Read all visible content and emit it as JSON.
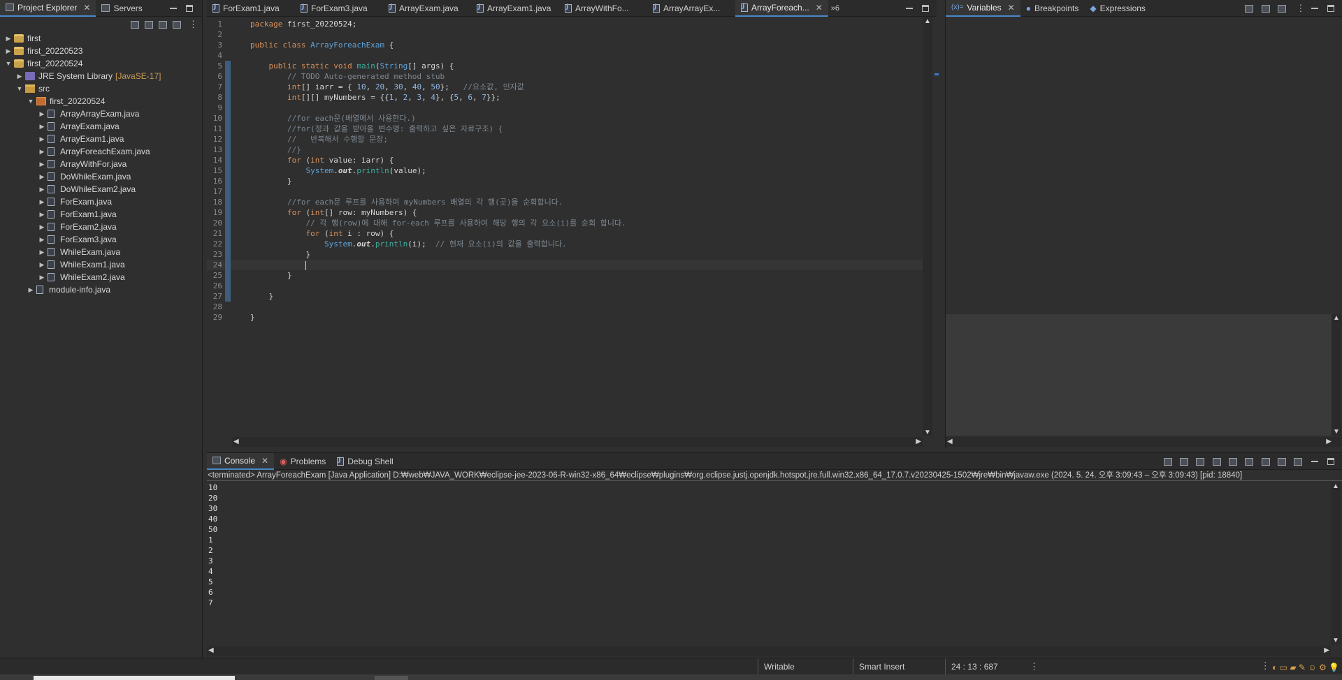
{
  "explorer": {
    "tabs": [
      {
        "label": "Project Explorer",
        "active": true
      },
      {
        "label": "Servers",
        "active": false
      }
    ],
    "tree": [
      {
        "label": "first",
        "kind": "project",
        "expanded": false,
        "depth": 0
      },
      {
        "label": "first_20220523",
        "kind": "project",
        "expanded": false,
        "depth": 0
      },
      {
        "label": "first_20220524",
        "kind": "project",
        "expanded": true,
        "depth": 0
      },
      {
        "label": "JRE System Library",
        "decor": "[JavaSE-17]",
        "kind": "library",
        "expanded": false,
        "depth": 1
      },
      {
        "label": "src",
        "kind": "source",
        "expanded": true,
        "depth": 1
      },
      {
        "label": "first_20220524",
        "kind": "package",
        "expanded": true,
        "depth": 2
      },
      {
        "label": "ArrayArrayExam.java",
        "kind": "java",
        "expanded": false,
        "depth": 3
      },
      {
        "label": "ArrayExam.java",
        "kind": "java",
        "expanded": false,
        "depth": 3
      },
      {
        "label": "ArrayExam1.java",
        "kind": "java",
        "expanded": false,
        "depth": 3
      },
      {
        "label": "ArrayForeachExam.java",
        "kind": "java",
        "expanded": false,
        "depth": 3
      },
      {
        "label": "ArrayWithFor.java",
        "kind": "java",
        "expanded": false,
        "depth": 3
      },
      {
        "label": "DoWhileExam.java",
        "kind": "java",
        "expanded": false,
        "depth": 3
      },
      {
        "label": "DoWhileExam2.java",
        "kind": "java",
        "expanded": false,
        "depth": 3
      },
      {
        "label": "ForExam.java",
        "kind": "java",
        "expanded": false,
        "depth": 3
      },
      {
        "label": "ForExam1.java",
        "kind": "java",
        "expanded": false,
        "depth": 3
      },
      {
        "label": "ForExam2.java",
        "kind": "java",
        "expanded": false,
        "depth": 3
      },
      {
        "label": "ForExam3.java",
        "kind": "java",
        "expanded": false,
        "depth": 3
      },
      {
        "label": "WhileExam.java",
        "kind": "java",
        "expanded": false,
        "depth": 3
      },
      {
        "label": "WhileExam1.java",
        "kind": "java",
        "expanded": false,
        "depth": 3
      },
      {
        "label": "WhileExam2.java",
        "kind": "java",
        "expanded": false,
        "depth": 3
      },
      {
        "label": "module-info.java",
        "kind": "java",
        "expanded": false,
        "depth": 2
      }
    ]
  },
  "editor": {
    "tabs": [
      {
        "label": "ForExam1.java",
        "active": false
      },
      {
        "label": "ForExam3.java",
        "active": false
      },
      {
        "label": "ArrayExam.java",
        "active": false
      },
      {
        "label": "ArrayExam1.java",
        "active": false
      },
      {
        "label": "ArrayWithFo...",
        "active": false
      },
      {
        "label": "ArrayArrayEx...",
        "active": false
      },
      {
        "label": "ArrayForeach...",
        "active": true
      }
    ],
    "overflow": "»6",
    "cursor_line": 24,
    "lines": [
      [
        {
          "t": "package",
          "c": "kw"
        },
        {
          "t": " first_20220524;"
        }
      ],
      [],
      [
        {
          "t": "public class ",
          "c": "kw"
        },
        {
          "t": "ArrayForeachExam",
          "c": "ty"
        },
        {
          "t": " {"
        }
      ],
      [],
      [
        {
          "t": "    public static void ",
          "c": "kw"
        },
        {
          "t": "main",
          "c": "fn"
        },
        {
          "t": "("
        },
        {
          "t": "String",
          "c": "ty"
        },
        {
          "t": "[] args) {"
        }
      ],
      [
        {
          "t": "        // TODO Auto-generated method stub",
          "c": "cm"
        }
      ],
      [
        {
          "t": "        "
        },
        {
          "t": "int",
          "c": "kw"
        },
        {
          "t": "[] iarr = { "
        },
        {
          "t": "10",
          "c": "num"
        },
        {
          "t": ", "
        },
        {
          "t": "20",
          "c": "num"
        },
        {
          "t": ", "
        },
        {
          "t": "30",
          "c": "num"
        },
        {
          "t": ", "
        },
        {
          "t": "40",
          "c": "num"
        },
        {
          "t": ", "
        },
        {
          "t": "50",
          "c": "num"
        },
        {
          "t": "};   "
        },
        {
          "t": "//요소값, 인자값",
          "c": "cm"
        }
      ],
      [
        {
          "t": "        "
        },
        {
          "t": "int",
          "c": "kw"
        },
        {
          "t": "[][] myNumbers = {{"
        },
        {
          "t": "1",
          "c": "num"
        },
        {
          "t": ", "
        },
        {
          "t": "2",
          "c": "num"
        },
        {
          "t": ", "
        },
        {
          "t": "3",
          "c": "num"
        },
        {
          "t": ", "
        },
        {
          "t": "4",
          "c": "num"
        },
        {
          "t": "}, {"
        },
        {
          "t": "5",
          "c": "num"
        },
        {
          "t": ", "
        },
        {
          "t": "6",
          "c": "num"
        },
        {
          "t": ", "
        },
        {
          "t": "7",
          "c": "num"
        },
        {
          "t": "}};"
        }
      ],
      [],
      [
        {
          "t": "        //for each문(배열에서 사용한다.)",
          "c": "cm"
        }
      ],
      [
        {
          "t": "        //for(정과 값을 받아올 변수명: 출력하고 싶은 자료구조) {",
          "c": "cm"
        }
      ],
      [
        {
          "t": "        //   반복해서 수행할 문장;",
          "c": "cm"
        }
      ],
      [
        {
          "t": "        //}",
          "c": "cm"
        }
      ],
      [
        {
          "t": "        "
        },
        {
          "t": "for",
          "c": "kw"
        },
        {
          "t": " ("
        },
        {
          "t": "int",
          "c": "kw"
        },
        {
          "t": " value: iarr) {"
        }
      ],
      [
        {
          "t": "            "
        },
        {
          "t": "System",
          "c": "ty"
        },
        {
          "t": "."
        },
        {
          "t": "out",
          "c": "st"
        },
        {
          "t": "."
        },
        {
          "t": "println",
          "c": "fn"
        },
        {
          "t": "(value);"
        }
      ],
      [
        {
          "t": "        }"
        }
      ],
      [],
      [
        {
          "t": "        //for each문 루프를 사용하여 myNumbers 배열의 각 행(곳)을 순회합니다.",
          "c": "cm"
        }
      ],
      [
        {
          "t": "        "
        },
        {
          "t": "for",
          "c": "kw"
        },
        {
          "t": " ("
        },
        {
          "t": "int",
          "c": "kw"
        },
        {
          "t": "[] row: myNumbers) {"
        }
      ],
      [
        {
          "t": "            // 각 행(row)에 대해 for-each 루프를 사용하여 해당 행의 각 요소(i)를 순회 합니다.",
          "c": "cm"
        }
      ],
      [
        {
          "t": "            "
        },
        {
          "t": "for",
          "c": "kw"
        },
        {
          "t": " ("
        },
        {
          "t": "int",
          "c": "kw"
        },
        {
          "t": " i : row) {"
        }
      ],
      [
        {
          "t": "                "
        },
        {
          "t": "System",
          "c": "ty"
        },
        {
          "t": "."
        },
        {
          "t": "out",
          "c": "st"
        },
        {
          "t": "."
        },
        {
          "t": "println",
          "c": "fn"
        },
        {
          "t": "(i);  "
        },
        {
          "t": "// 현재 요소(i)의 값을 출력합니다.",
          "c": "cm"
        }
      ],
      [
        {
          "t": "            }"
        }
      ],
      [
        {
          "t": "            "
        }
      ],
      [
        {
          "t": "        }"
        }
      ],
      [],
      [
        {
          "t": "    }"
        }
      ],
      [],
      [
        {
          "t": "}"
        }
      ]
    ]
  },
  "debug_view": {
    "tabs": [
      {
        "label": "Variables",
        "active": true
      },
      {
        "label": "Breakpoints",
        "active": false
      },
      {
        "label": "Expressions",
        "active": false
      }
    ]
  },
  "console": {
    "tabs": [
      {
        "label": "Console",
        "active": true
      },
      {
        "label": "Problems",
        "active": false
      },
      {
        "label": "Debug Shell",
        "active": false
      }
    ],
    "header": "<terminated> ArrayForeachExam [Java Application] D:₩web₩JAVA_WORK₩eclipse-jee-2023-06-R-win32-x86_64₩eclipse₩plugins₩org.eclipse.justj.openjdk.hotspot.jre.full.win32.x86_64_17.0.7.v20230425-1502₩jre₩bin₩javaw.exe  (2024. 5. 24. 오후 3:09:43 – 오후 3:09:43) [pid: 18840]",
    "output": [
      "10",
      "20",
      "30",
      "40",
      "50",
      "1",
      "2",
      "3",
      "4",
      "5",
      "6",
      "7"
    ]
  },
  "status": {
    "writable": "Writable",
    "insert_mode": "Smart Insert",
    "position": "24 : 13 : 687"
  }
}
